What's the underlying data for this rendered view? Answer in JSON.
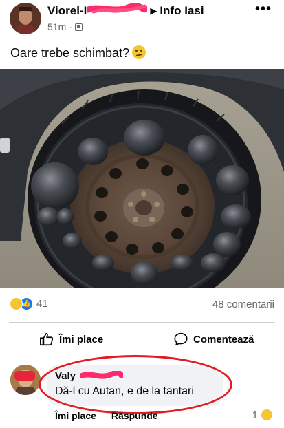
{
  "post": {
    "author_visible": "Viorel-I",
    "group": "Info Iasi",
    "time": "51m",
    "text": "Oare trebe schimbat?"
  },
  "reactions": {
    "count": "41",
    "comments": "48 comentarii"
  },
  "actions": {
    "like": "Îmi place",
    "comment": "Comentează"
  },
  "comment": {
    "author_visible": "Valy",
    "text": "Dă-l cu Autan, e de la tantari",
    "like": "Îmi place",
    "reply": "Răspunde",
    "reaction_count": "1"
  },
  "colors": {
    "accent": "#1877f2",
    "annotation_red": "#e21b24",
    "muted_text": "#65676b",
    "bubble": "#f0f2f5"
  },
  "icons": [
    "avatar",
    "privacy-icon",
    "more-icon",
    "thinking-face-icon",
    "haha-icon",
    "like-icon",
    "thumbs-up-icon",
    "comment-icon"
  ]
}
